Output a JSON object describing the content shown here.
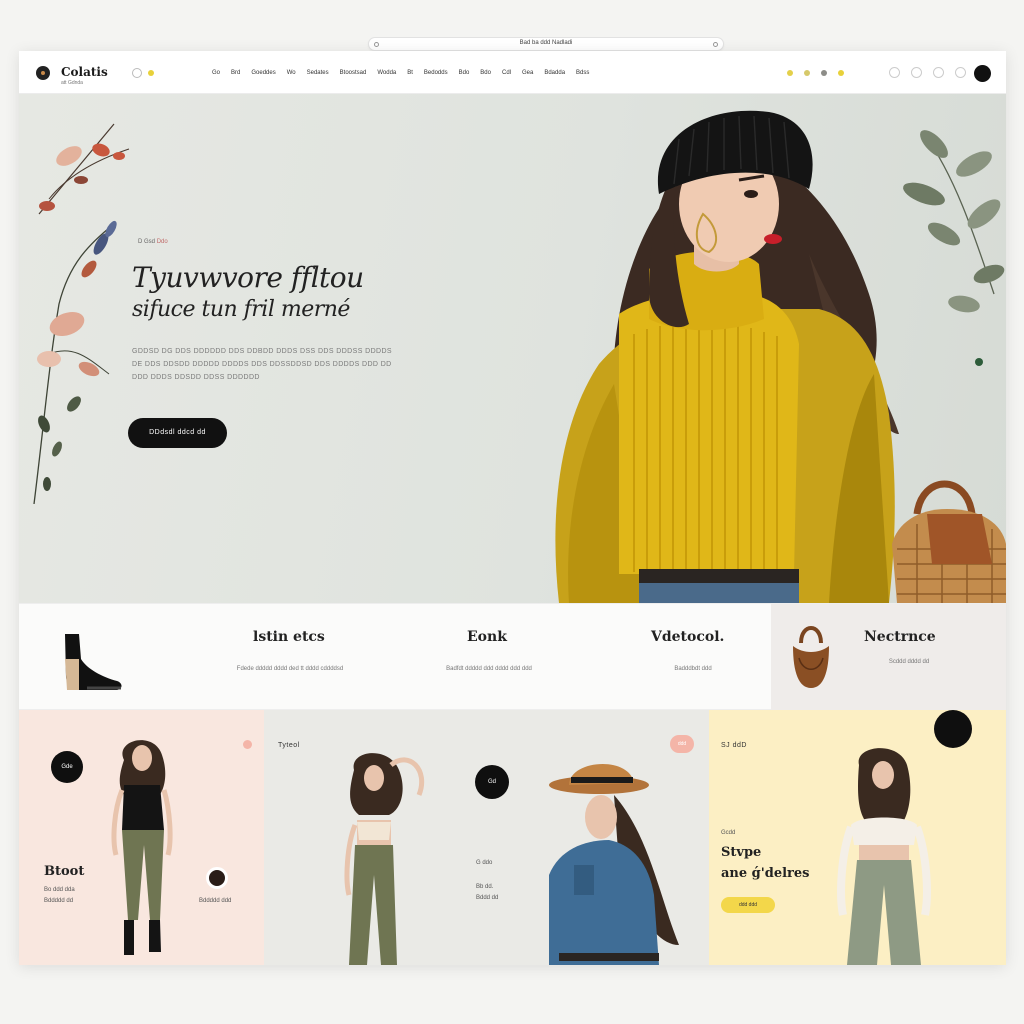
{
  "browser": {
    "url": "Bad ba ddd Nadladi"
  },
  "header": {
    "logo": "Colatis",
    "logo_sub": "att Gdnda",
    "nav": [
      "Go",
      "Brd",
      "Goeddes",
      "Wo",
      "Sedates",
      "Btoostsad",
      "Wodda",
      "Bt",
      "Bedodds",
      "Bdo",
      "Bdo",
      "Cdl",
      "Gea",
      "Bdadda",
      "Bdss"
    ],
    "colors": [
      "#e4d04a",
      "#d6c96a",
      "#8d8d88",
      "#e8d13a"
    ]
  },
  "hero": {
    "eyebrow": "D Gsd",
    "eyebrow_accent": "Ddo",
    "title_line1": "Tyuvwvore ffltou",
    "title_line2": "sifuce tun fril merné",
    "body": "GDDSD DG DDS DDDDDD DDS DDBDD DDDS DSS DDS DDDSS DDDDS DE DDS DDSDD DDDDD DDDDS DDS DDSSDDSD DDS DDDDS DDD DD DDD DDDS DDSDD DDSS DDDDDD",
    "cta": "DDdsdl ddcd dd"
  },
  "products": [
    {
      "title": "lstin etcs",
      "desc": "Fdede ddddd dddd ded tt dddd cddddsd"
    },
    {
      "title": "Eonk",
      "desc": "Badfdt ddddd ddd dddd ddd ddd"
    },
    {
      "title": "Vdetocol.",
      "desc": "Badddbdt ddd"
    },
    {
      "title": "Nectrnce",
      "desc": "Scddd dddd dd"
    }
  ],
  "tiles": {
    "t1": {
      "badge": "Gde",
      "title": "Btoot",
      "sub1": "Bo ddd dda",
      "sub2": "Bddddd dd",
      "avatar_caption": "Bddddd ddd"
    },
    "t2": {
      "label": "Tyteol",
      "badge": "Gd",
      "sub1": "G ddo",
      "sub2": "Bb dd.",
      "sub3": "Bddd dd",
      "pill": "ddd"
    },
    "t3": {
      "label": "SJ ddD",
      "title1": "Stvpe",
      "title2": "ane ǵ'delres",
      "small": "Gcdd",
      "pill": "ddd ddd",
      "badge": ""
    }
  }
}
